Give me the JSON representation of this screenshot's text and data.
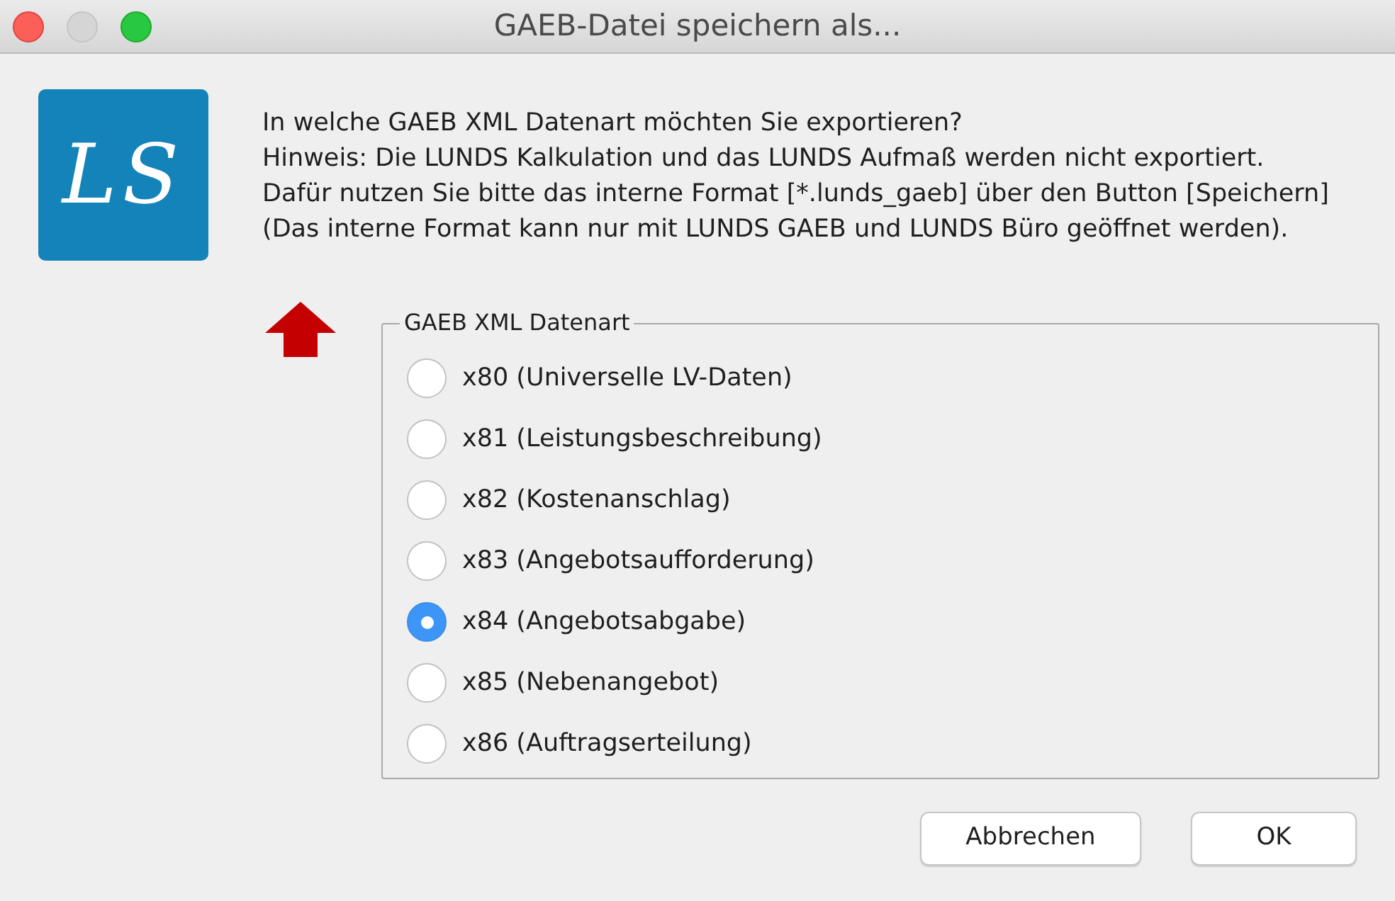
{
  "window": {
    "title": "GAEB-Datei speichern als...",
    "controls": [
      {
        "kind": "close",
        "disabled": false
      },
      {
        "kind": "minimize",
        "disabled": true
      },
      {
        "kind": "zoom",
        "disabled": false
      }
    ]
  },
  "logo": {
    "text": "LS"
  },
  "message": [
    "In welche GAEB XML Datenart möchten Sie exportieren?",
    "Hinweis: Die LUNDS Kalkulation und das LUNDS Aufmaß werden nicht exportiert.",
    "Dafür nutzen Sie bitte das interne Format [*.lunds_gaeb] über den Button [Speichern]",
    "(Das interne Format kann nur mit LUNDS GAEB und LUNDS Büro geöffnet werden)."
  ],
  "group": {
    "legend": "GAEB XML Datenart",
    "options": [
      {
        "label": "x80 (Universelle LV-Daten)",
        "selected": false
      },
      {
        "label": "x81 (Leistungsbeschreibung)",
        "selected": false
      },
      {
        "label": "x82 (Kostenanschlag)",
        "selected": false
      },
      {
        "label": "x83 (Angebotsaufforderung)",
        "selected": false
      },
      {
        "label": "x84 (Angebotsabgabe)",
        "selected": true
      },
      {
        "label": "x85 (Nebenangebot)",
        "selected": false
      },
      {
        "label": "x86 (Auftragserteilung)",
        "selected": false
      }
    ]
  },
  "buttons": [
    {
      "label": "Abbrechen"
    },
    {
      "label": "OK"
    }
  ]
}
